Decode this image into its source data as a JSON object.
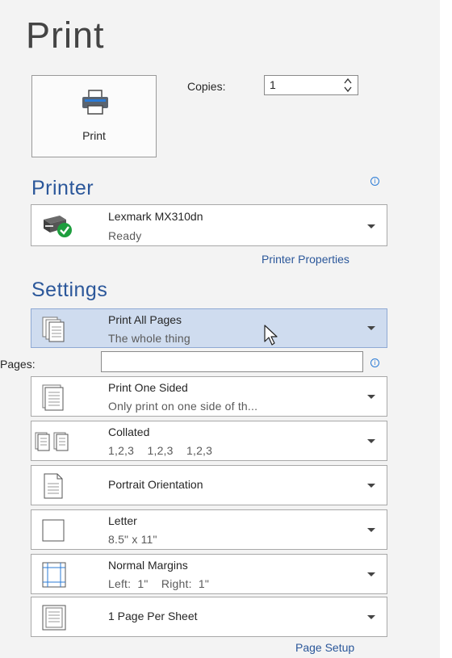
{
  "title": "Print",
  "print_button": {
    "label": "Print"
  },
  "copies": {
    "label": "Copies:",
    "value": "1"
  },
  "printer": {
    "heading": "Printer",
    "name": "Lexmark MX310dn",
    "status": "Ready",
    "properties_link": "Printer Properties"
  },
  "settings": {
    "heading": "Settings",
    "print_range": {
      "title": "Print All Pages",
      "subtitle": "The whole thing"
    },
    "pages": {
      "label": "Pages:",
      "value": "",
      "placeholder": ""
    },
    "sides": {
      "title": "Print One Sided",
      "subtitle": "Only print on one side of th..."
    },
    "collation": {
      "title": "Collated",
      "subtitle": "1,2,3    1,2,3    1,2,3"
    },
    "orientation": {
      "title": "Portrait Orientation"
    },
    "paper": {
      "title": "Letter",
      "subtitle": "8.5\" x 11\""
    },
    "margins": {
      "title": "Normal Margins",
      "subtitle": "Left:  1\"    Right:  1\""
    },
    "pages_per_sheet": {
      "title": "1 Page Per Sheet"
    },
    "page_setup_link": "Page Setup"
  },
  "icons": {
    "printer": "printer-icon",
    "printer_ready": "printer-ready-icon",
    "info": "info-icon",
    "dropdown": "chevron-down-icon"
  },
  "colors": {
    "accent": "#2b579a",
    "selected": "#cfdcef",
    "ready_green": "#1e9e3e"
  }
}
